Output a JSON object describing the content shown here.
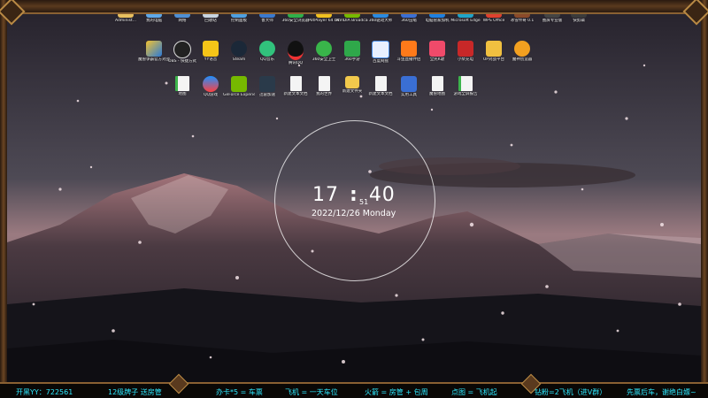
{
  "desktop": {
    "row1": [
      "Administ...",
      "我的电脑",
      "网络",
      "回收站",
      "控制面板",
      "鲁大师",
      "360安全浏览器",
      "PotPlayer 64 bit",
      "NVIDIA Broadcast",
      "360驱动大师",
      "360压缩",
      "电脑管家加机",
      "Microsoft Edge",
      "WPS Office",
      "冰雪传奇 0.1",
      "图屏专业版",
      "快剪辑"
    ],
    "row2": [
      "魔兽争霸官方对战平台",
      "OBS - 快捷方式",
      "YY语音",
      "Steam",
      "QQ音乐",
      "腾讯QQ",
      "360安全卫士",
      "360手游",
      "百度网盘",
      "斗鱼直播伴侣",
      "全民K歌",
      "小柴充电",
      "UP对战平台",
      "魔神创造器"
    ],
    "row3": [
      "地图",
      "QQ游戏",
      "GeForce Experience",
      "迅雷加速",
      "新建文本文档",
      "我的世界",
      "新建文件夹",
      "新建文本文档",
      "实用工具",
      "魔兽地图",
      "游戏全屏报告"
    ]
  },
  "clock": {
    "hours": "17",
    "minutes": "40",
    "seconds": "51",
    "date": "2022/12/26 Monday"
  },
  "ticker": [
    "开黑YY：722561",
    "12级牌子 送房管",
    "办卡*5 = 车票",
    "飞机 = 一天车位",
    "火箭 = 房管 + 包周",
    "点图 = 飞机起",
    "钻粉=2飞机（进V群）",
    "先票后车，谢绝白嫖~"
  ],
  "colors": {
    "ticker_text": "#2ee9ff",
    "frame_gold": "#b98a45"
  }
}
